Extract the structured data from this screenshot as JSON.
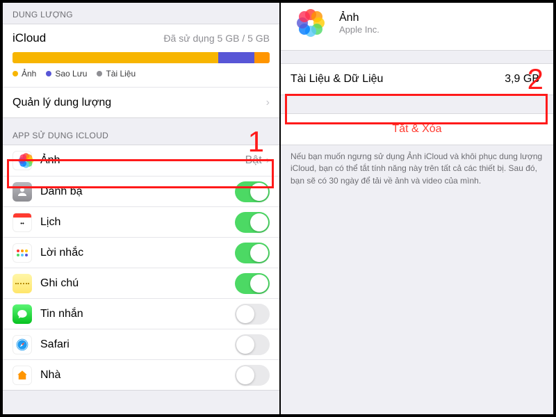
{
  "colors": {
    "accent_yellow": "#f7b500",
    "accent_purple": "#5856d6",
    "accent_orange": "#ff9500",
    "toggle_on": "#4cd964",
    "destructive": "#ff3b30",
    "highlight": "#ff1a1a"
  },
  "left": {
    "storage_header": "DUNG LƯỢNG",
    "service": "iCloud",
    "usage_text": "Đã sử dụng 5 GB / 5 GB",
    "segments": [
      {
        "label_key": "legend.0",
        "color": "#f7b500",
        "width_pct": 80
      },
      {
        "label_key": "legend.1",
        "color": "#5856d6",
        "width_pct": 14
      },
      {
        "label_key": "legend.2",
        "color": "#ff9500",
        "width_pct": 6
      }
    ],
    "legend": [
      "Ảnh",
      "Sao Lưu",
      "Tài Liệu"
    ],
    "manage_label": "Quản lý dung lượng",
    "apps_header": "APP SỬ DỤNG ICLOUD",
    "photos_row": {
      "label": "Ảnh",
      "state": "Bật"
    },
    "apps": [
      {
        "icon": "contacts",
        "label": "Danh bạ",
        "on": true
      },
      {
        "icon": "calendar",
        "label": "Lịch",
        "on": true
      },
      {
        "icon": "reminders",
        "label": "Lời nhắc",
        "on": true
      },
      {
        "icon": "notes",
        "label": "Ghi chú",
        "on": true
      },
      {
        "icon": "messages",
        "label": "Tin nhắn",
        "on": false
      },
      {
        "icon": "safari",
        "label": "Safari",
        "on": false
      },
      {
        "icon": "home",
        "label": "Nhà",
        "on": false
      }
    ],
    "step_number": "1"
  },
  "right": {
    "app_name": "Ảnh",
    "publisher": "Apple Inc.",
    "data_label": "Tài Liệu & Dữ Liệu",
    "data_size": "3,9 GB",
    "action_label": "Tắt & Xóa",
    "footer": "Nếu bạn muốn ngưng sử dụng Ảnh iCloud và khôi phục dung lượng iCloud, bạn có thể tắt tính năng này trên tất cả các thiết bị. Sau đó, bạn sẽ có 30 ngày để tải về ảnh và video của mình.",
    "step_number": "2"
  }
}
